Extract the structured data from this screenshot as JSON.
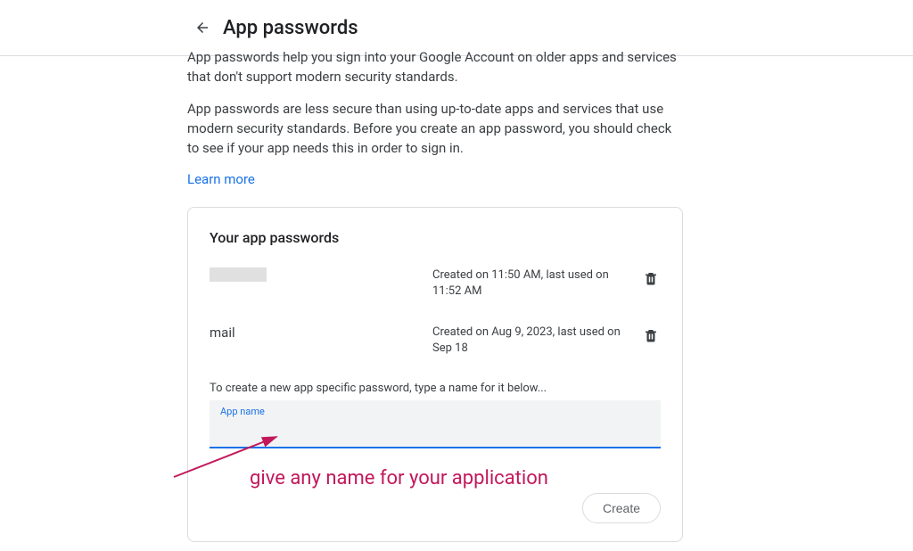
{
  "header": {
    "title": "App passwords"
  },
  "intro": {
    "p1": "App passwords help you sign into your Google Account on older apps and services that don't support modern security standards.",
    "p2": "App passwords are less secure than using up-to-date apps and services that use modern security standards. Before you create an app password, you should check to see if your app needs this in order to sign in.",
    "learn": "Learn more"
  },
  "card": {
    "title": "Your app passwords",
    "rows": [
      {
        "name": "",
        "meta": "Created on 11:50 AM, last used on 11:52 AM"
      },
      {
        "name": "mail",
        "meta": "Created on Aug 9, 2023, last used on Sep 18"
      }
    ],
    "create_hint": "To create a new app specific password, type a name for it below...",
    "input_label": "App name",
    "create_button": "Create"
  },
  "annotation": {
    "text": "give any name for your application"
  }
}
